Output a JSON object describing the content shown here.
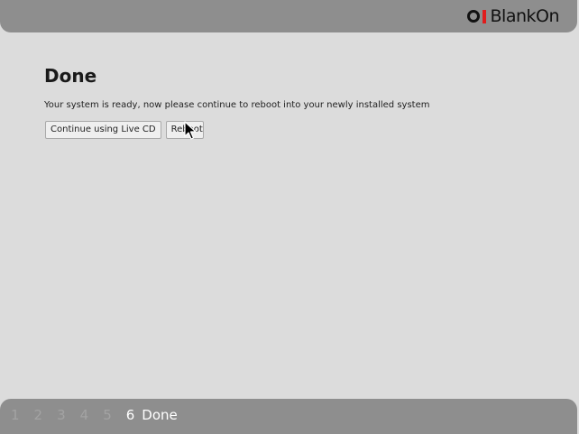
{
  "header": {
    "brand_name": "BlankOn",
    "brand_accent_color": "#e01c1c"
  },
  "main": {
    "title": "Done",
    "message": "Your system is ready, now please continue to reboot into your newly installed system",
    "buttons": {
      "continue_label": "Continue using Live CD",
      "reboot_label": "Reboot"
    }
  },
  "footer": {
    "steps": [
      "1",
      "2",
      "3",
      "4",
      "5",
      "6"
    ],
    "current_step_label": "Done"
  },
  "colors": {
    "background": "#dcdcdc",
    "bar": "#8e8e8e",
    "step_inactive": "#a3a3a3",
    "step_active": "#ffffff"
  }
}
